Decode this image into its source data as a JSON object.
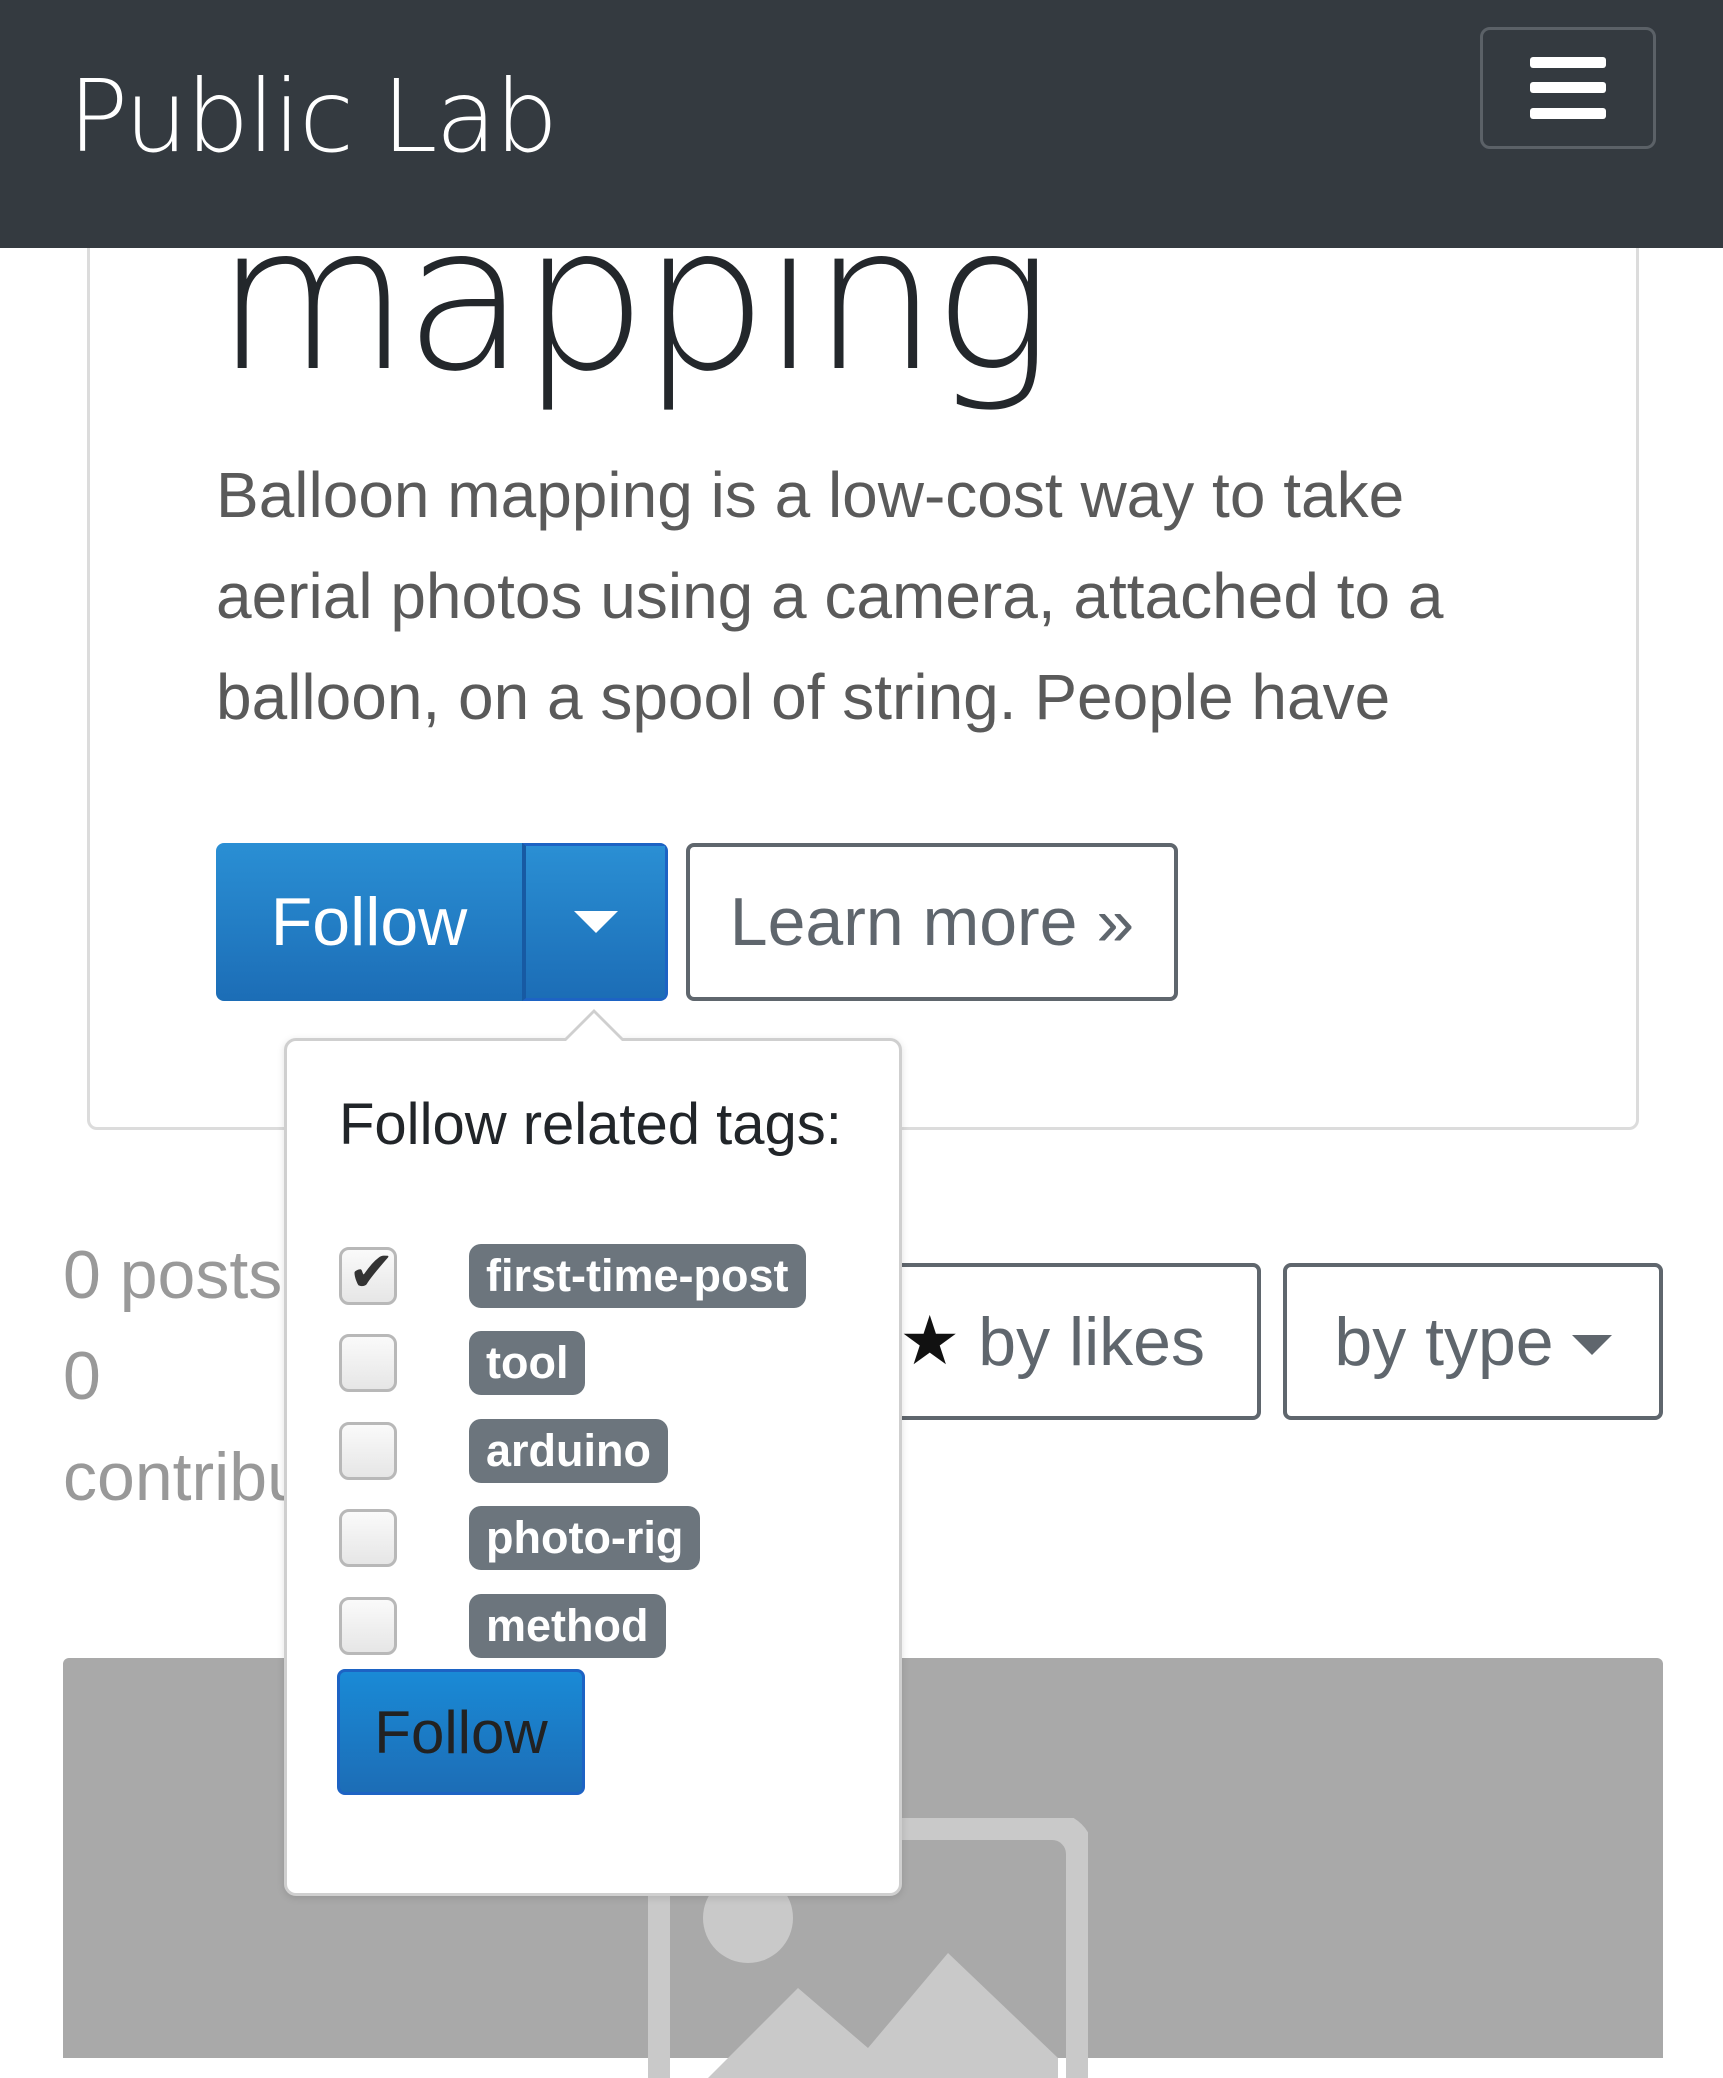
{
  "navbar": {
    "brand": "Public Lab",
    "menu_icon": "hamburger-icon"
  },
  "header": {
    "title": "mapping",
    "description": "Balloon mapping is a low-cost way to take aerial photos using a camera, attached to a balloon, on a spool of string. People have",
    "follow_label": "Follow",
    "learn_more_label": "Learn more »"
  },
  "stats": {
    "posts": "0 posts",
    "contributors_count": "0",
    "contributors_label": "contribu"
  },
  "sort": {
    "likes_label": "by likes",
    "type_label": "by type"
  },
  "popover": {
    "title": "Follow related tags:",
    "tags": [
      {
        "label": "first-time-post",
        "checked": true
      },
      {
        "label": "tool",
        "checked": false
      },
      {
        "label": "arduino",
        "checked": false
      },
      {
        "label": "photo-rig",
        "checked": false
      },
      {
        "label": "method",
        "checked": false
      }
    ],
    "follow_label": "Follow"
  },
  "colors": {
    "navbar": "#343a40",
    "primary": "#1c7cc4",
    "badge": "#6c757d"
  }
}
